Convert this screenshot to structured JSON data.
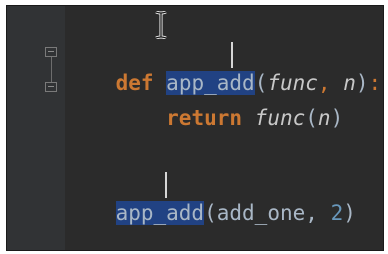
{
  "editor": {
    "line1": {
      "keyword": "def",
      "function_name": "app_add",
      "open_paren": "(",
      "param1": "func",
      "comma": ",",
      "param2": "n",
      "close_paren": ")",
      "colon": ":"
    },
    "line2": {
      "keyword": "return",
      "call_name": "func",
      "open_paren": "(",
      "arg": "n",
      "close_paren": ")"
    },
    "line3": {
      "function_name": "app_add",
      "open_paren": "(",
      "arg1": "add_one",
      "comma": ",",
      "arg2": "2",
      "close_paren": ")"
    }
  },
  "colors": {
    "background": "#2b2b2b",
    "gutter": "#313335",
    "keyword": "#cc7832",
    "selection": "#214283",
    "number": "#6897bb",
    "text": "#a9b7c6"
  },
  "icons": [
    "fold-marker-icon",
    "text-cursor-icon"
  ]
}
